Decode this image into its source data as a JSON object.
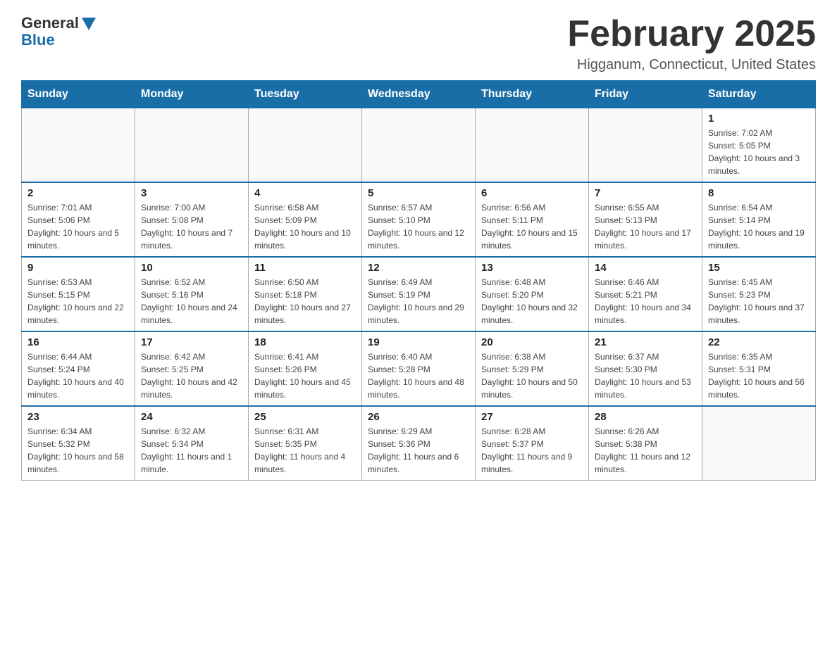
{
  "header": {
    "logo_general": "General",
    "logo_blue": "Blue",
    "month_title": "February 2025",
    "location": "Higganum, Connecticut, United States"
  },
  "days_of_week": [
    "Sunday",
    "Monday",
    "Tuesday",
    "Wednesday",
    "Thursday",
    "Friday",
    "Saturday"
  ],
  "weeks": [
    [
      {
        "day": "",
        "info": ""
      },
      {
        "day": "",
        "info": ""
      },
      {
        "day": "",
        "info": ""
      },
      {
        "day": "",
        "info": ""
      },
      {
        "day": "",
        "info": ""
      },
      {
        "day": "",
        "info": ""
      },
      {
        "day": "1",
        "info": "Sunrise: 7:02 AM\nSunset: 5:05 PM\nDaylight: 10 hours and 3 minutes."
      }
    ],
    [
      {
        "day": "2",
        "info": "Sunrise: 7:01 AM\nSunset: 5:06 PM\nDaylight: 10 hours and 5 minutes."
      },
      {
        "day": "3",
        "info": "Sunrise: 7:00 AM\nSunset: 5:08 PM\nDaylight: 10 hours and 7 minutes."
      },
      {
        "day": "4",
        "info": "Sunrise: 6:58 AM\nSunset: 5:09 PM\nDaylight: 10 hours and 10 minutes."
      },
      {
        "day": "5",
        "info": "Sunrise: 6:57 AM\nSunset: 5:10 PM\nDaylight: 10 hours and 12 minutes."
      },
      {
        "day": "6",
        "info": "Sunrise: 6:56 AM\nSunset: 5:11 PM\nDaylight: 10 hours and 15 minutes."
      },
      {
        "day": "7",
        "info": "Sunrise: 6:55 AM\nSunset: 5:13 PM\nDaylight: 10 hours and 17 minutes."
      },
      {
        "day": "8",
        "info": "Sunrise: 6:54 AM\nSunset: 5:14 PM\nDaylight: 10 hours and 19 minutes."
      }
    ],
    [
      {
        "day": "9",
        "info": "Sunrise: 6:53 AM\nSunset: 5:15 PM\nDaylight: 10 hours and 22 minutes."
      },
      {
        "day": "10",
        "info": "Sunrise: 6:52 AM\nSunset: 5:16 PM\nDaylight: 10 hours and 24 minutes."
      },
      {
        "day": "11",
        "info": "Sunrise: 6:50 AM\nSunset: 5:18 PM\nDaylight: 10 hours and 27 minutes."
      },
      {
        "day": "12",
        "info": "Sunrise: 6:49 AM\nSunset: 5:19 PM\nDaylight: 10 hours and 29 minutes."
      },
      {
        "day": "13",
        "info": "Sunrise: 6:48 AM\nSunset: 5:20 PM\nDaylight: 10 hours and 32 minutes."
      },
      {
        "day": "14",
        "info": "Sunrise: 6:46 AM\nSunset: 5:21 PM\nDaylight: 10 hours and 34 minutes."
      },
      {
        "day": "15",
        "info": "Sunrise: 6:45 AM\nSunset: 5:23 PM\nDaylight: 10 hours and 37 minutes."
      }
    ],
    [
      {
        "day": "16",
        "info": "Sunrise: 6:44 AM\nSunset: 5:24 PM\nDaylight: 10 hours and 40 minutes."
      },
      {
        "day": "17",
        "info": "Sunrise: 6:42 AM\nSunset: 5:25 PM\nDaylight: 10 hours and 42 minutes."
      },
      {
        "day": "18",
        "info": "Sunrise: 6:41 AM\nSunset: 5:26 PM\nDaylight: 10 hours and 45 minutes."
      },
      {
        "day": "19",
        "info": "Sunrise: 6:40 AM\nSunset: 5:28 PM\nDaylight: 10 hours and 48 minutes."
      },
      {
        "day": "20",
        "info": "Sunrise: 6:38 AM\nSunset: 5:29 PM\nDaylight: 10 hours and 50 minutes."
      },
      {
        "day": "21",
        "info": "Sunrise: 6:37 AM\nSunset: 5:30 PM\nDaylight: 10 hours and 53 minutes."
      },
      {
        "day": "22",
        "info": "Sunrise: 6:35 AM\nSunset: 5:31 PM\nDaylight: 10 hours and 56 minutes."
      }
    ],
    [
      {
        "day": "23",
        "info": "Sunrise: 6:34 AM\nSunset: 5:32 PM\nDaylight: 10 hours and 58 minutes."
      },
      {
        "day": "24",
        "info": "Sunrise: 6:32 AM\nSunset: 5:34 PM\nDaylight: 11 hours and 1 minute."
      },
      {
        "day": "25",
        "info": "Sunrise: 6:31 AM\nSunset: 5:35 PM\nDaylight: 11 hours and 4 minutes."
      },
      {
        "day": "26",
        "info": "Sunrise: 6:29 AM\nSunset: 5:36 PM\nDaylight: 11 hours and 6 minutes."
      },
      {
        "day": "27",
        "info": "Sunrise: 6:28 AM\nSunset: 5:37 PM\nDaylight: 11 hours and 9 minutes."
      },
      {
        "day": "28",
        "info": "Sunrise: 6:26 AM\nSunset: 5:38 PM\nDaylight: 11 hours and 12 minutes."
      },
      {
        "day": "",
        "info": ""
      }
    ]
  ],
  "colors": {
    "header_bg": "#1a6ea8",
    "header_text": "#ffffff",
    "border": "#aaaaaa",
    "text_main": "#333333"
  }
}
